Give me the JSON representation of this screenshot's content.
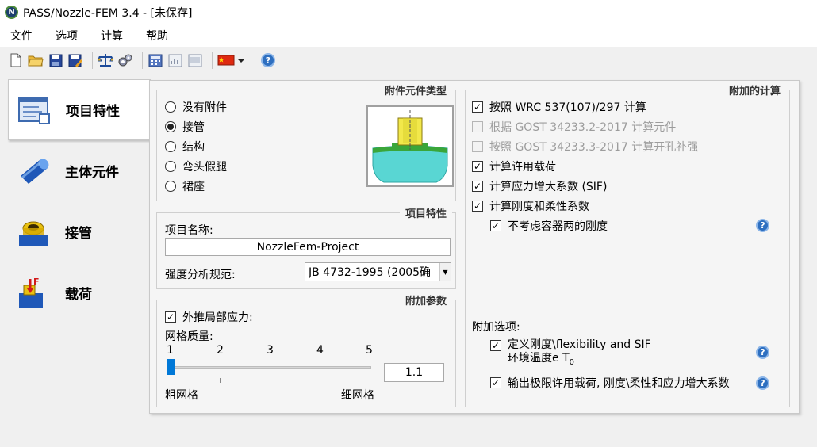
{
  "window": {
    "title": "PASS/Nozzle-FEM 3.4 - [未保存]",
    "app_icon_letter": "N"
  },
  "menu": [
    "文件",
    "选项",
    "计算",
    "帮助"
  ],
  "nav": {
    "items": [
      "项目特性",
      "主体元件",
      "接管",
      "载荷"
    ],
    "active_index": 0
  },
  "attachment_group": {
    "title": "附件元件类型",
    "options": [
      "没有附件",
      "接管",
      "结构",
      "弯头假腿",
      "裙座"
    ],
    "selected_index": 1
  },
  "project_group": {
    "title": "项目特性",
    "name_label": "项目名称:",
    "name_value": "NozzleFem-Project",
    "code_label": "强度分析规范:",
    "code_value": "JB 4732-1995 (2005确"
  },
  "params_group": {
    "title": "附加参数",
    "extrapolate_label": "外推局部应力:",
    "extrapolate_checked": true,
    "mesh_label": "网格质量:",
    "mesh_ticks": [
      "1",
      "2",
      "3",
      "4",
      "5"
    ],
    "mesh_value": 1,
    "coarse_label": "粗网格",
    "fine_label": "细网格",
    "factor_value": "1.1"
  },
  "calc_group": {
    "title": "附加的计算",
    "items": [
      {
        "label": "按照 WRC 537(107)/297 计算",
        "checked": true,
        "enabled": true
      },
      {
        "label": "根据 GOST 34233.2-2017 计算元件",
        "checked": false,
        "enabled": false
      },
      {
        "label": "按照 GOST 34233.3-2017 计算开孔补强",
        "checked": false,
        "enabled": false
      },
      {
        "label": "计算许用载荷",
        "checked": true,
        "enabled": true
      },
      {
        "label": "计算应力增大系数 (SIF)",
        "checked": true,
        "enabled": true
      },
      {
        "label": "计算刚度和柔性系数",
        "checked": true,
        "enabled": true
      },
      {
        "label": "不考虑容器两的刚度",
        "checked": true,
        "enabled": true
      }
    ],
    "options_label": "附加选项:",
    "option1_line1": "定义刚度\\flexibility and SIF",
    "option1_line2": "环境温度e T",
    "option1_sub": "0",
    "option1_checked": true,
    "option2": "输出极限许用载荷, 刚度\\柔性和应力增大系数",
    "option2_checked": true
  },
  "help_glyph": "?",
  "check_glyph": "✓",
  "colors": {
    "accent": "#0078d7",
    "help": "#2e6fc0",
    "nozzle_yellow": "#f2e84b",
    "vessel_cyan": "#59d6d3",
    "flange_green": "#3aa63a"
  }
}
